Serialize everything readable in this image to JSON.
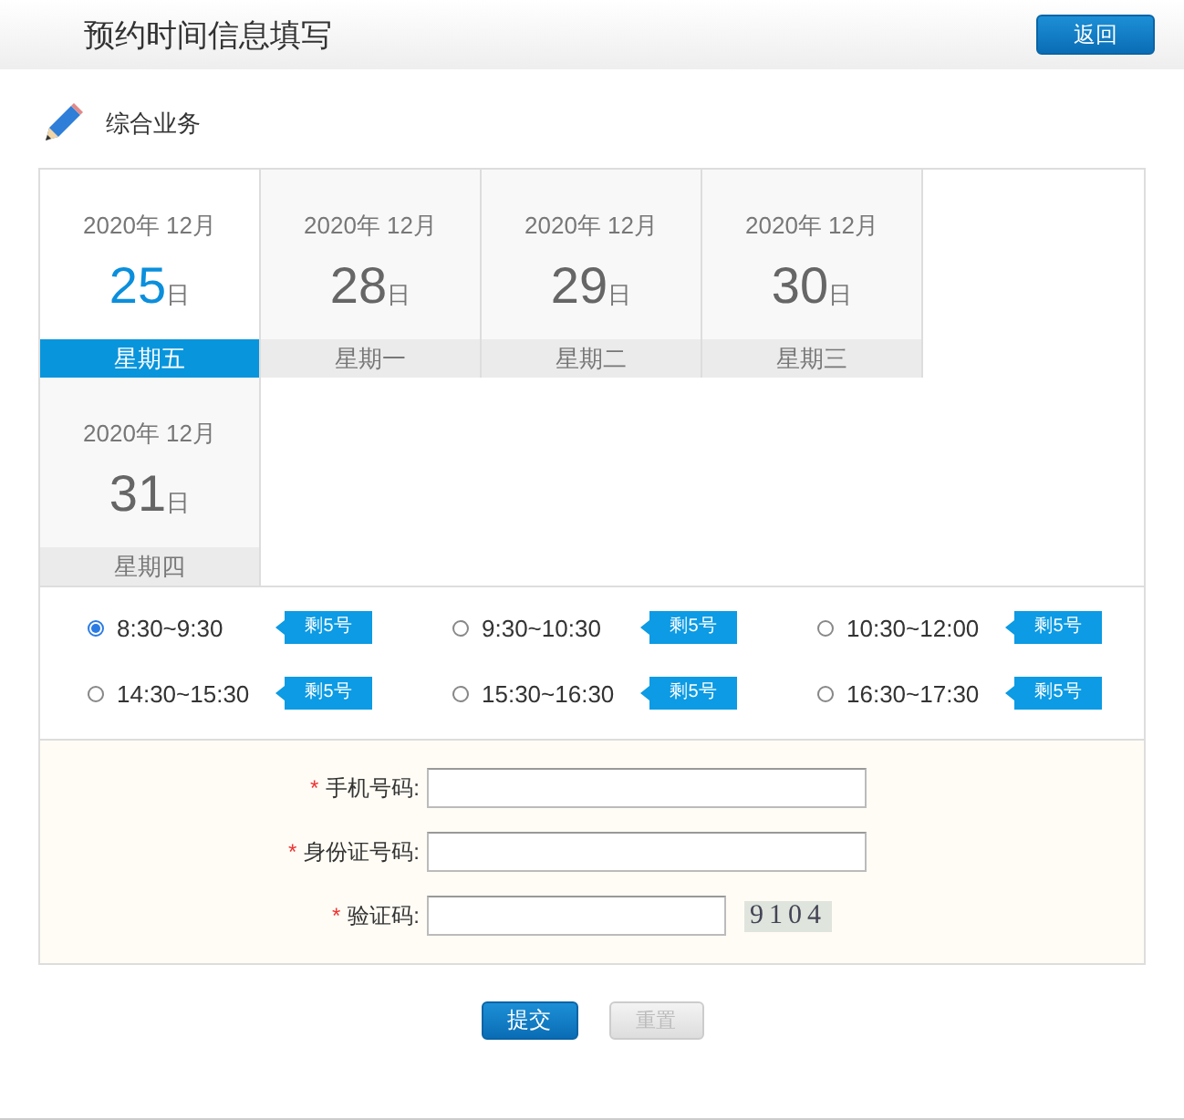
{
  "header": {
    "title": "预约时间信息填写",
    "back_button": "返回"
  },
  "section": {
    "title": "综合业务"
  },
  "dates": [
    {
      "year_month": "2020年 12月",
      "day": "25",
      "day_unit": "日",
      "weekday": "星期五",
      "selected": true
    },
    {
      "year_month": "2020年 12月",
      "day": "28",
      "day_unit": "日",
      "weekday": "星期一",
      "selected": false
    },
    {
      "year_month": "2020年 12月",
      "day": "29",
      "day_unit": "日",
      "weekday": "星期二",
      "selected": false
    },
    {
      "year_month": "2020年 12月",
      "day": "30",
      "day_unit": "日",
      "weekday": "星期三",
      "selected": false
    },
    {
      "year_month": "2020年 12月",
      "day": "31",
      "day_unit": "日",
      "weekday": "星期四",
      "selected": false
    }
  ],
  "slots": [
    {
      "time": "8:30~9:30",
      "remaining": "剩5号",
      "selected": true
    },
    {
      "time": "9:30~10:30",
      "remaining": "剩5号",
      "selected": false
    },
    {
      "time": "10:30~12:00",
      "remaining": "剩5号",
      "selected": false
    },
    {
      "time": "14:30~15:30",
      "remaining": "剩5号",
      "selected": false
    },
    {
      "time": "15:30~16:30",
      "remaining": "剩5号",
      "selected": false
    },
    {
      "time": "16:30~17:30",
      "remaining": "剩5号",
      "selected": false
    }
  ],
  "form": {
    "fields": [
      {
        "required_mark": "*",
        "label": "手机号码:",
        "kind": "text"
      },
      {
        "required_mark": "*",
        "label": "身份证号码:",
        "kind": "text"
      },
      {
        "required_mark": "*",
        "label": "验证码:",
        "kind": "captcha",
        "captcha": "9104"
      }
    ]
  },
  "buttons": {
    "submit": "提交",
    "reset": {
      "label": "重置",
      "disabled": true
    }
  }
}
